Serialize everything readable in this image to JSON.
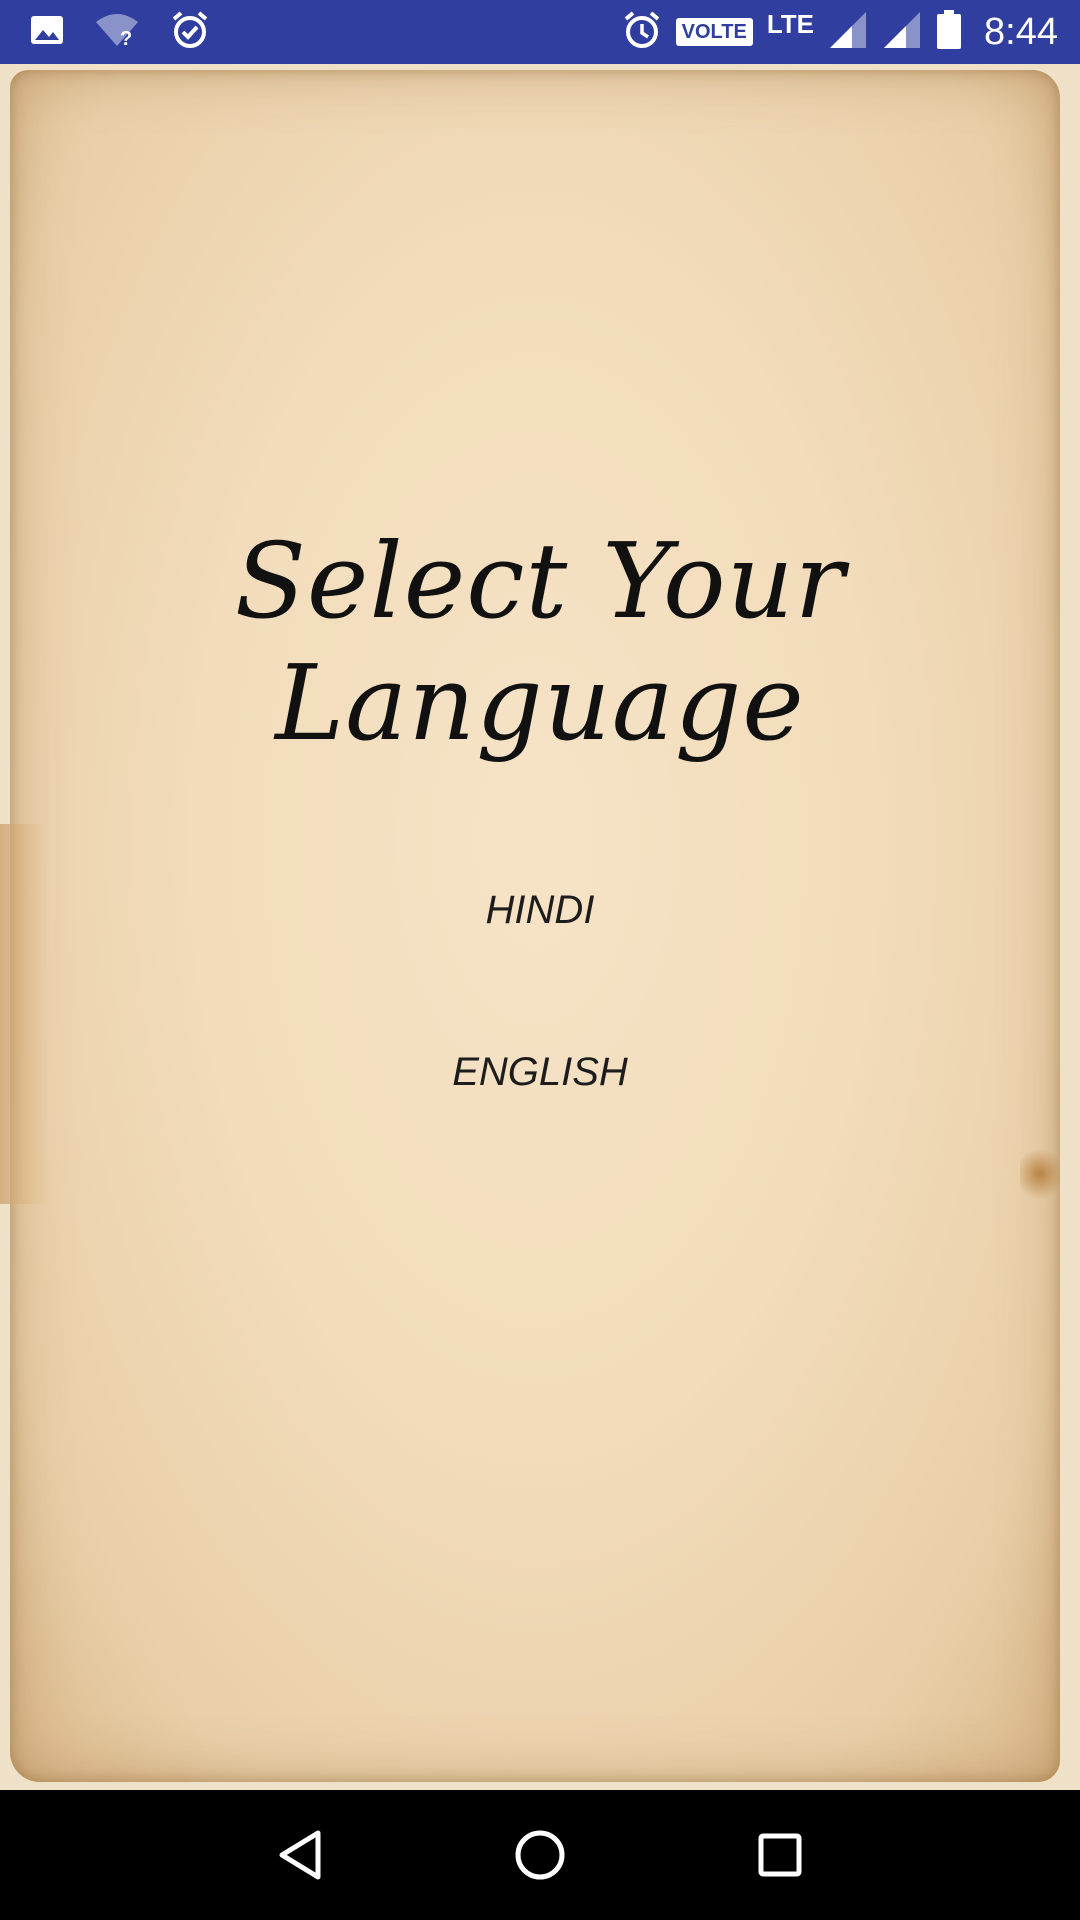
{
  "status_bar": {
    "icons_left": [
      "image-icon",
      "wifi-question-icon",
      "alarm-check-icon"
    ],
    "icons_right": [
      "alarm-icon",
      "volte-badge",
      "lte-label",
      "signal-icon",
      "signal-icon",
      "battery-icon"
    ],
    "volte_label": "VOLTE",
    "network_label": "LTE",
    "time": "8:44",
    "background_color": "#303F9F"
  },
  "screen": {
    "title": "Select Your Language",
    "languages": [
      {
        "label": "HINDI"
      },
      {
        "label": "ENGLISH"
      }
    ]
  },
  "nav_bar": {
    "buttons": [
      "back-icon",
      "home-icon",
      "recents-icon"
    ]
  }
}
